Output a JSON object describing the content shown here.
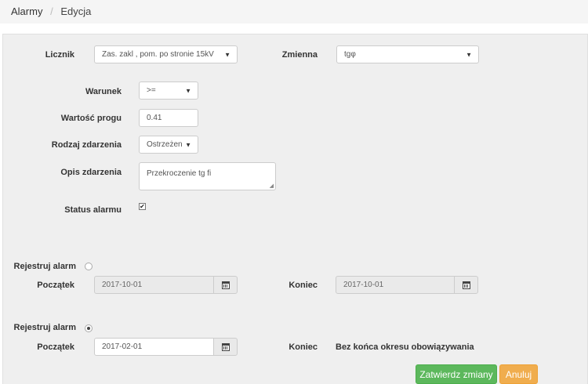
{
  "breadcrumb": {
    "parent": "Alarmy",
    "separator": "/",
    "current": "Edycja"
  },
  "form": {
    "licznik": {
      "label": "Licznik",
      "value": "Zas. zakl , pom. po stronie 15kV"
    },
    "zmienna": {
      "label": "Zmienna",
      "value": "tgφ"
    },
    "warunek": {
      "label": "Warunek",
      "value": ">="
    },
    "wartosc_progu": {
      "label": "Wartość progu",
      "value": "0.41"
    },
    "rodzaj_zdarzenia": {
      "label": "Rodzaj zdarzenia",
      "value": "Ostrzeżen"
    },
    "opis_zdarzenia": {
      "label": "Opis zdarzenia",
      "value": "Przekroczenie tg fi"
    },
    "status_alarmu": {
      "label": "Status alarmu",
      "checked": true
    }
  },
  "register1": {
    "label": "Rejestruj alarm",
    "selected": false,
    "start_label": "Początek",
    "start_value": "2017-10-01",
    "end_label": "Koniec",
    "end_value": "2017-10-01"
  },
  "register2": {
    "label": "Rejestruj alarm",
    "selected": true,
    "start_label": "Początek",
    "start_value": "2017-02-01",
    "end_label": "Koniec",
    "end_text": "Bez końca okresu obowiązywania"
  },
  "buttons": {
    "submit": "Zatwierdz zmiany",
    "cancel": "Anuluj"
  },
  "colors": {
    "success": "#5cb85c",
    "warning": "#f0ad4e",
    "panel": "#efefef"
  },
  "icons": {
    "select_caret": "caret-down-icon",
    "calendar": "calendar-icon",
    "checkbox_mark": "✔"
  }
}
